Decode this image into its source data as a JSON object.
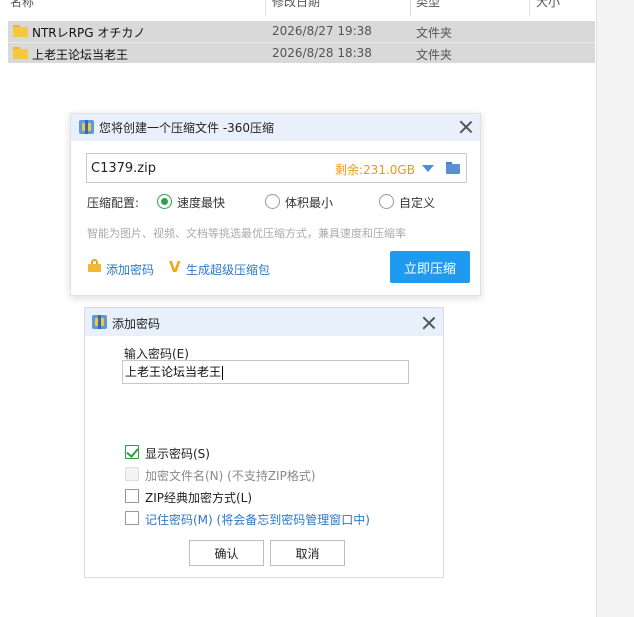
{
  "explorer": {
    "columns": [
      "名称",
      "修改日期",
      "类型",
      "大小"
    ],
    "rows": [
      {
        "name": "NTRレRPG オチカノ",
        "date": "2026/8/27 19:38",
        "type": "文件夹"
      },
      {
        "name": "上老王论坛当老王",
        "date": "2026/8/28 18:38",
        "type": "文件夹"
      }
    ]
  },
  "compress_dialog": {
    "title": "您将创建一个压缩文件 -360压缩",
    "filename": "C1379.zip",
    "free_space": "剩余:231.0GB",
    "config_label": "压缩配置:",
    "options": [
      "速度最快",
      "体积最小",
      "自定义"
    ],
    "selected_option": "速度最快",
    "hint": "智能为图片、视频、文档等挑选最优压缩方式，兼具速度和压缩率",
    "add_password_link": "添加密码",
    "super_link": "生成超级压缩包",
    "compress_button": "立即压缩"
  },
  "password_dialog": {
    "title": "添加密码",
    "input_label": "输入密码(E)",
    "password_value": "上老王论坛当老王",
    "checkboxes": [
      {
        "label": "显示密码(S)",
        "checked": true,
        "enabled": true
      },
      {
        "label": "加密文件名(N) (不支持ZIP格式)",
        "checked": false,
        "enabled": false
      },
      {
        "label": "ZIP经典加密方式(L)",
        "checked": false,
        "enabled": true
      },
      {
        "label": "记住密码(M) (将会备忘到密码管理窗口中)",
        "checked": false,
        "enabled": true
      }
    ],
    "ok_button": "确认",
    "cancel_button": "取消"
  },
  "colors": {
    "accent_blue": "#1e9bf0",
    "link_blue": "#2d78c8",
    "check_green": "#2ba245",
    "free_space_orange": "#e39a1c",
    "title_bar": "#e8f1fb"
  },
  "icons": [
    "folder-icon",
    "app-icon",
    "close-icon",
    "dropdown-arrow-icon",
    "browse-folder-icon",
    "lock-icon",
    "v-icon"
  ]
}
